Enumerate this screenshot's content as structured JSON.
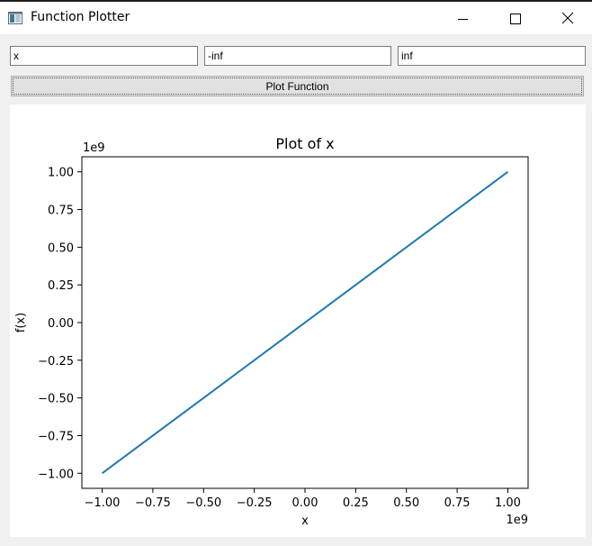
{
  "window": {
    "title": "Function Plotter",
    "icon": "app-window-icon",
    "controls": [
      "minimize-icon",
      "maximize-icon",
      "close-icon"
    ]
  },
  "inputs": {
    "function_value": "x",
    "min_value": "-inf",
    "max_value": "inf"
  },
  "plot_button": {
    "label": "Plot Function"
  },
  "chart_data": {
    "type": "line",
    "title": "Plot of x",
    "xlabel": "x",
    "ylabel": "f(x)",
    "x_offset_text": "1e9",
    "y_offset_text": "1e9",
    "xlim": [
      -1.1,
      1.1
    ],
    "ylim": [
      -1.1,
      1.1
    ],
    "x_ticks": [
      -1.0,
      -0.75,
      -0.5,
      -0.25,
      0.0,
      0.25,
      0.5,
      0.75,
      1.0
    ],
    "y_ticks": [
      -1.0,
      -0.75,
      -0.5,
      -0.25,
      0.0,
      0.25,
      0.5,
      0.75,
      1.0
    ],
    "x_tick_labels": [
      "−1.00",
      "−0.75",
      "−0.50",
      "−0.25",
      "0.00",
      "0.25",
      "0.50",
      "0.75",
      "1.00"
    ],
    "y_tick_labels": [
      "−1.00",
      "−0.75",
      "−0.50",
      "−0.25",
      "0.00",
      "0.25",
      "0.50",
      "0.75",
      "1.00"
    ],
    "grid": false,
    "series": [
      {
        "color": "#1f77b4",
        "x": [
          -1.0,
          1.0
        ],
        "y": [
          -1.0,
          1.0
        ]
      }
    ]
  }
}
